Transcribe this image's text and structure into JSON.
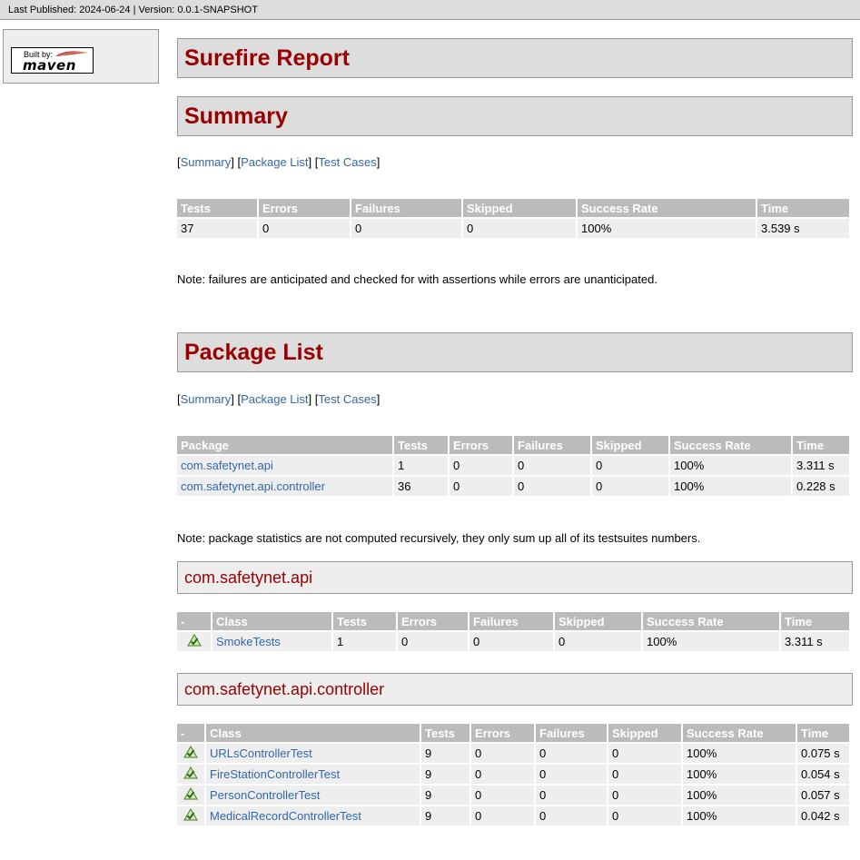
{
  "banner": {
    "text": "Last Published: 2024-06-24 | Version: 0.0.1-SNAPSHOT"
  },
  "badge": {
    "built_by": "Built by:",
    "brand": "maven"
  },
  "title": "Surefire Report",
  "summary": {
    "heading": "Summary",
    "nav": [
      "Summary",
      "Package List",
      "Test Cases"
    ],
    "headers": [
      "Tests",
      "Errors",
      "Failures",
      "Skipped",
      "Success Rate",
      "Time"
    ],
    "row": [
      "37",
      "0",
      "0",
      "0",
      "100%",
      "3.539 s"
    ],
    "note": "Note: failures are anticipated and checked for with assertions while errors are unanticipated."
  },
  "package_list": {
    "heading": "Package List",
    "nav": [
      "Summary",
      "Package List",
      "Test Cases"
    ],
    "headers": [
      "Package",
      "Tests",
      "Errors",
      "Failures",
      "Skipped",
      "Success Rate",
      "Time"
    ],
    "rows": [
      [
        "com.safetynet.api",
        "1",
        "0",
        "0",
        "0",
        "100%",
        "3.311 s"
      ],
      [
        "com.safetynet.api.controller",
        "36",
        "0",
        "0",
        "0",
        "100%",
        "0.228 s"
      ]
    ],
    "note": "Note: package statistics are not computed recursively, they only sum up all of its testsuites numbers."
  },
  "packages": [
    {
      "name": "com.safetynet.api",
      "headers": [
        "-",
        "Class",
        "Tests",
        "Errors",
        "Failures",
        "Skipped",
        "Success Rate",
        "Time"
      ],
      "rows": [
        [
          "SmokeTests",
          "1",
          "0",
          "0",
          "0",
          "100%",
          "3.311 s"
        ]
      ]
    },
    {
      "name": "com.safetynet.api.controller",
      "headers": [
        "-",
        "Class",
        "Tests",
        "Errors",
        "Failures",
        "Skipped",
        "Success Rate",
        "Time"
      ],
      "rows": [
        [
          "URLsControllerTest",
          "9",
          "0",
          "0",
          "0",
          "100%",
          "0.075 s"
        ],
        [
          "FireStationControllerTest",
          "9",
          "0",
          "0",
          "0",
          "100%",
          "0.054 s"
        ],
        [
          "PersonControllerTest",
          "9",
          "0",
          "0",
          "0",
          "100%",
          "0.057 s"
        ],
        [
          "MedicalRecordControllerTest",
          "9",
          "0",
          "0",
          "0",
          "100%",
          "0.042 s"
        ]
      ]
    }
  ],
  "icons": {
    "status": "success-icon"
  },
  "colors": {
    "heading": "#990000",
    "link": "#3366aa",
    "header_bg": "#bbbbbb",
    "cell_bg": "#eeeeee"
  }
}
